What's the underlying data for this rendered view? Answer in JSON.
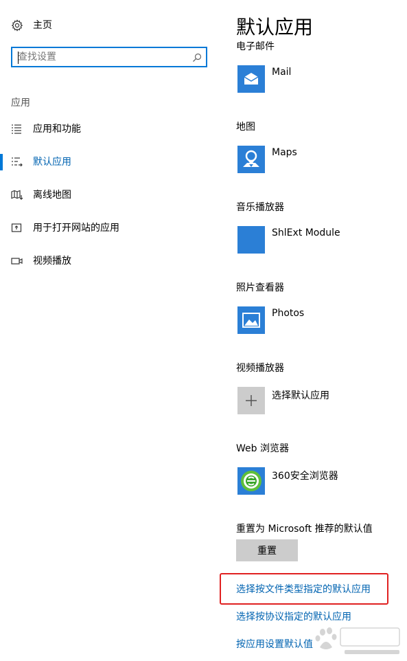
{
  "sidebar": {
    "home_label": "主页",
    "search_placeholder": "查找设置",
    "category_label": "应用",
    "items": [
      {
        "label": "应用和功能",
        "icon": "list-icon"
      },
      {
        "label": "默认应用",
        "icon": "default-apps-icon",
        "active": true
      },
      {
        "label": "离线地图",
        "icon": "offline-map-icon"
      },
      {
        "label": "用于打开网站的应用",
        "icon": "open-website-icon"
      },
      {
        "label": "视频播放",
        "icon": "video-icon"
      }
    ]
  },
  "main": {
    "title": "默认应用",
    "sections": [
      {
        "heading": "电子邮件",
        "app": "Mail",
        "icon": "mail-icon"
      },
      {
        "heading": "地图",
        "app": "Maps",
        "icon": "maps-icon"
      },
      {
        "heading": "音乐播放器",
        "app": "ShlExt Module",
        "icon": "blank-app-icon"
      },
      {
        "heading": "照片查看器",
        "app": "Photos",
        "icon": "photos-icon"
      },
      {
        "heading": "视频播放器",
        "app": "选择默认应用",
        "icon": "plus-icon"
      },
      {
        "heading": "Web 浏览器",
        "app": "360安全浏览器",
        "icon": "browser-360-icon"
      }
    ],
    "reset_heading": "重置为 Microsoft 推荐的默认值",
    "reset_button": "重置",
    "links": [
      "选择按文件类型指定的默认应用",
      "选择按协议指定的默认应用",
      "按应用设置默认值"
    ]
  },
  "colors": {
    "accent": "#0078d7",
    "link": "#0063b1",
    "tile": "#2b7fd6",
    "highlight": "#e02020"
  }
}
